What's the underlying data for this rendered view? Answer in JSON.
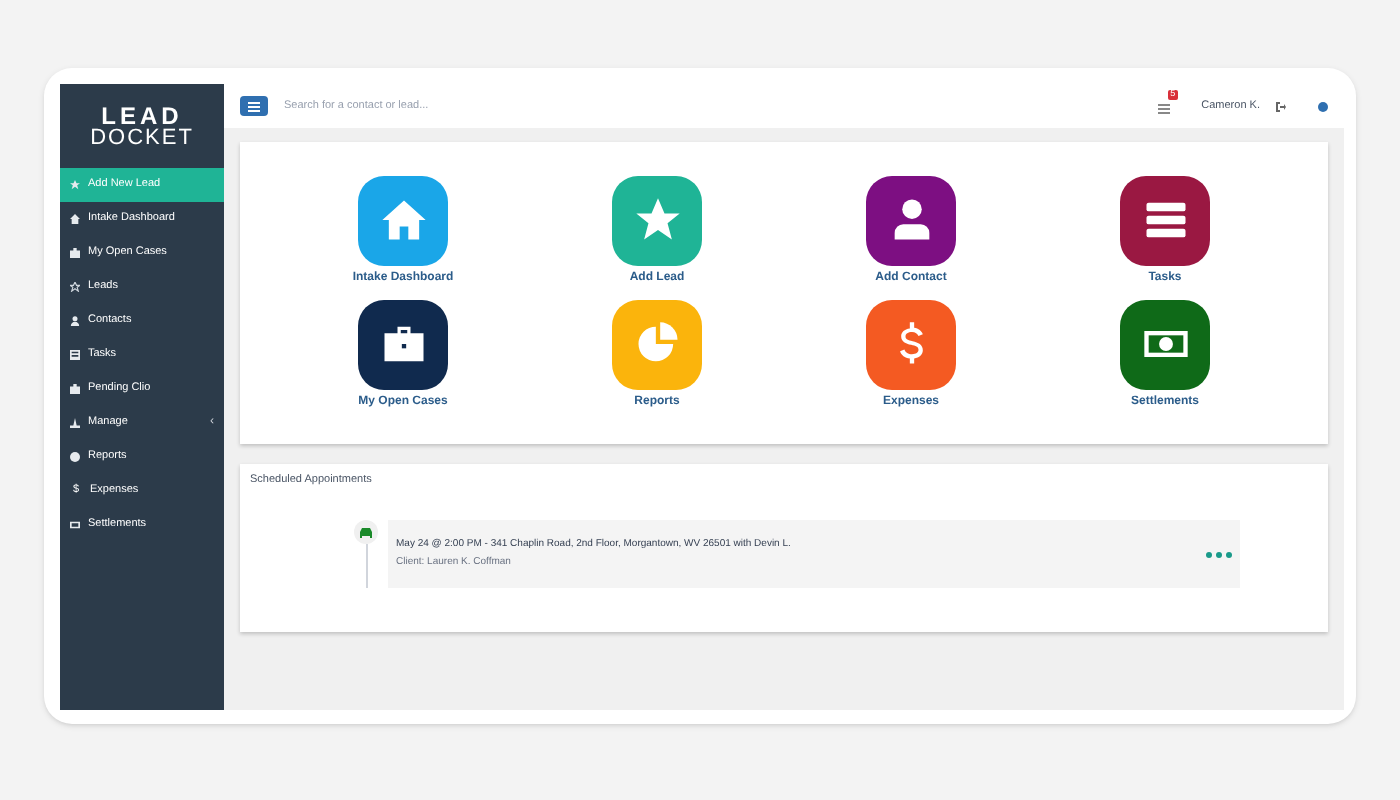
{
  "logo": {
    "line_1": "LEAD",
    "line_2": "DOCKET"
  },
  "sidebar": {
    "items": [
      {
        "label": "Add New Lead",
        "selected": true
      },
      {
        "label": "Intake Dashboard",
        "selected": false
      },
      {
        "label": "My Open Cases",
        "selected": false
      },
      {
        "label": "Leads",
        "selected": false
      },
      {
        "label": "Contacts",
        "selected": false
      },
      {
        "label": "Tasks",
        "selected": false
      },
      {
        "label": "Pending Clio",
        "selected": false
      },
      {
        "label": "Manage",
        "selected": false,
        "chevron": "‹"
      },
      {
        "label": "Reports",
        "selected": false
      },
      {
        "label": "Expenses",
        "selected": false,
        "glyph": "$"
      },
      {
        "label": "Settlements",
        "selected": false
      }
    ]
  },
  "topbar": {
    "search": {
      "placeholder": "Search for a contact or lead..."
    },
    "notification_count": "5",
    "user": "Cameron K."
  },
  "tiles": [
    {
      "label": "Intake Dashboard",
      "color": "#1aa6e8"
    },
    {
      "label": "Add Lead",
      "color": "#1fb496"
    },
    {
      "label": "Add Contact",
      "color": "#7d0f82"
    },
    {
      "label": "Tasks",
      "color": "#9a1842"
    },
    {
      "label": "My Open Cases",
      "color": "#102a4e"
    },
    {
      "label": "Reports",
      "color": "#fbb40c"
    },
    {
      "label": "Expenses",
      "color": "#f45a22"
    },
    {
      "label": "Settlements",
      "color": "#0f6a18"
    }
  ],
  "appointments": {
    "title": "Scheduled Appointments",
    "items": [
      {
        "line_1": "May 24 @ 2:00 PM - 341 Chaplin Road, 2nd Floor, Morgantown, WV 26501 with Devin L.",
        "line_2": "Client: Lauren K. Coffman"
      }
    ]
  }
}
